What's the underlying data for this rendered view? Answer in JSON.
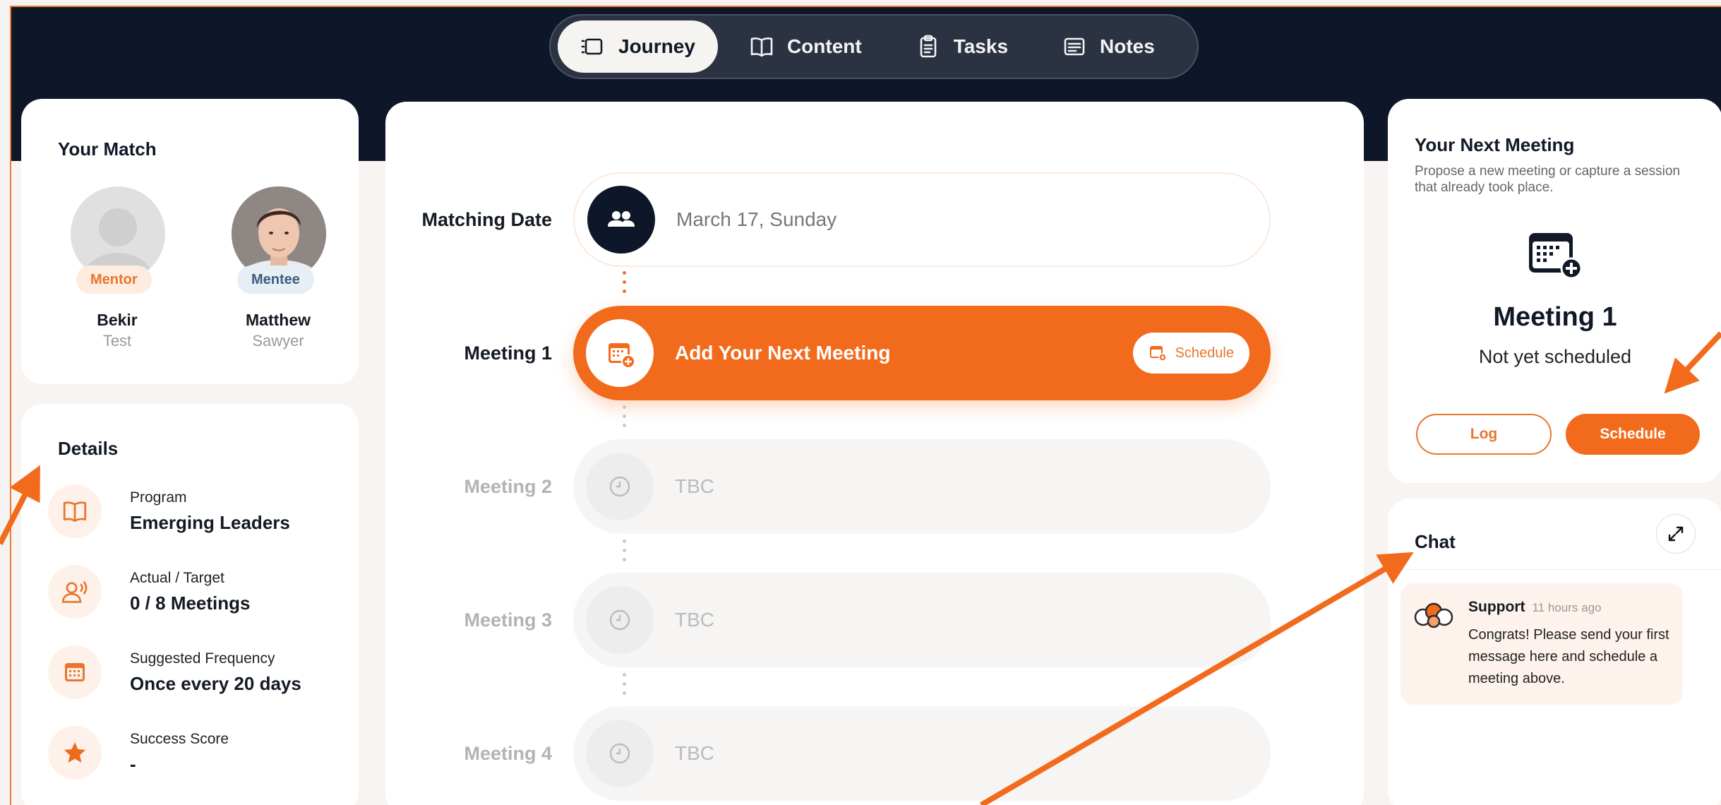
{
  "nav": {
    "tabs": [
      {
        "label": "Journey",
        "icon": "journey-icon",
        "active": true
      },
      {
        "label": "Content",
        "icon": "book-open-icon",
        "active": false
      },
      {
        "label": "Tasks",
        "icon": "clipboard-icon",
        "active": false
      },
      {
        "label": "Notes",
        "icon": "notes-icon",
        "active": false
      }
    ]
  },
  "match": {
    "title": "Your Match",
    "mentor": {
      "role": "Mentor",
      "first": "Bekir",
      "last": "Test"
    },
    "mentee": {
      "role": "Mentee",
      "first": "Matthew",
      "last": "Sawyer"
    }
  },
  "details": {
    "title": "Details",
    "items": [
      {
        "icon": "book-icon",
        "label": "Program",
        "value": "Emerging Leaders"
      },
      {
        "icon": "person-voice-icon",
        "label": "Actual / Target",
        "value": "0 / 8 Meetings"
      },
      {
        "icon": "calendar-icon",
        "label": "Suggested Frequency",
        "value": "Once every 20 days"
      },
      {
        "icon": "star-icon",
        "label": "Success Score",
        "value": "-"
      }
    ]
  },
  "journey": {
    "matching": {
      "label": "Matching Date",
      "value": "March 17, Sunday"
    },
    "active": {
      "label": "Meeting 1",
      "text": "Add Your Next Meeting",
      "button": "Schedule"
    },
    "pending": [
      {
        "label": "Meeting 2",
        "text": "TBC"
      },
      {
        "label": "Meeting 3",
        "text": "TBC"
      },
      {
        "label": "Meeting 4",
        "text": "TBC"
      }
    ]
  },
  "next_meeting": {
    "title": "Your Next Meeting",
    "subtitle": "Propose a new meeting or capture a session that already took place.",
    "meeting_name": "Meeting 1",
    "status": "Not yet scheduled",
    "log_label": "Log",
    "schedule_label": "Schedule"
  },
  "chat": {
    "title": "Chat",
    "message": {
      "author": "Support",
      "time": "11 hours ago",
      "text": "Congrats! Please send your first message here and schedule a meeting above."
    }
  },
  "colors": {
    "accent": "#f26b1d",
    "navy": "#0e1729",
    "mentor_badge_bg": "#fdecdf",
    "mentee_badge_bg": "#e6eef6"
  }
}
